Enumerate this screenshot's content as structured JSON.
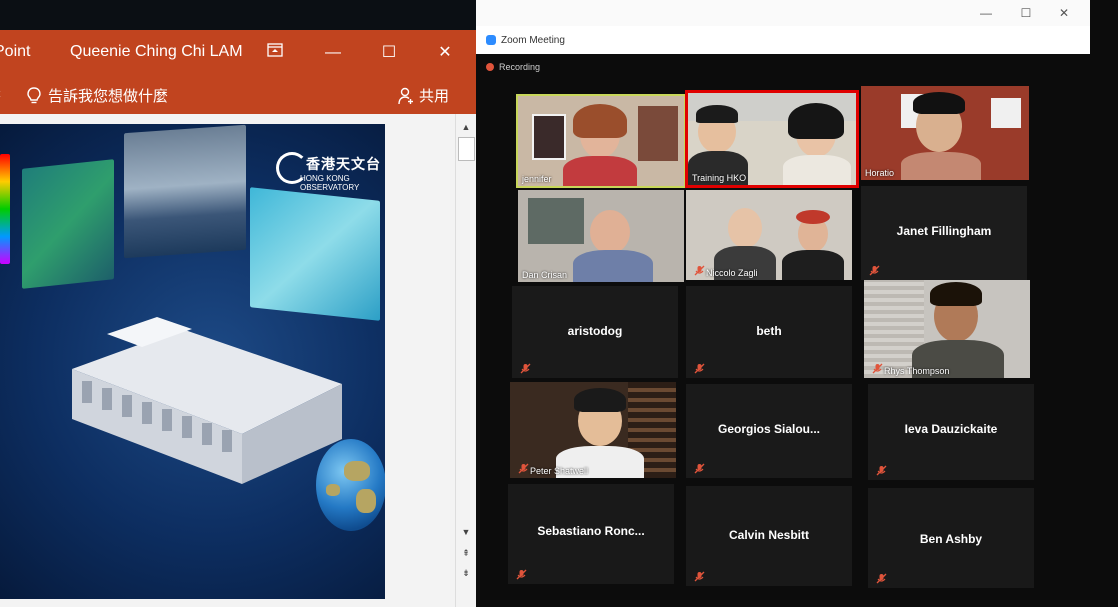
{
  "ppt": {
    "app_name": "Point",
    "user_name": "Queenie Ching Chi LAM",
    "tell_me": "告訴我您想做什麼",
    "share": "共用",
    "logo_text": "香港天文台",
    "logo_sub": "HONG KONG OBSERVATORY",
    "accent": "#c1441f"
  },
  "zoom": {
    "title": "Zoom Meeting",
    "recording": "Recording",
    "participants": [
      {
        "name": "jennifer",
        "video": true,
        "speaking": true
      },
      {
        "name": "Training HKO",
        "video": true,
        "active": true
      },
      {
        "name": "Horatio",
        "video": true
      },
      {
        "name": "Dan Crisan",
        "video": true
      },
      {
        "name": "Niccolo Zagli",
        "video": true,
        "muted": true
      },
      {
        "name": "Janet Fillingham",
        "video": false,
        "muted": true
      },
      {
        "name": "aristodog",
        "video": false,
        "muted": true
      },
      {
        "name": "beth",
        "video": false,
        "muted": true
      },
      {
        "name": "Rhys Thompson",
        "video": true,
        "muted": true
      },
      {
        "name": "Peter Shatwell",
        "video": true,
        "muted": true
      },
      {
        "name": "Georgios Sialou...",
        "video": false,
        "muted": true
      },
      {
        "name": "Ieva Dauzickaite",
        "video": false,
        "muted": true
      },
      {
        "name": "Sebastiano Ronc...",
        "video": false,
        "muted": true
      },
      {
        "name": "Calvin Nesbitt",
        "video": false,
        "muted": true
      },
      {
        "name": "Ben Ashby",
        "video": false,
        "muted": true
      }
    ],
    "active_color": "#e00000",
    "muted_color": "#e0543b"
  }
}
